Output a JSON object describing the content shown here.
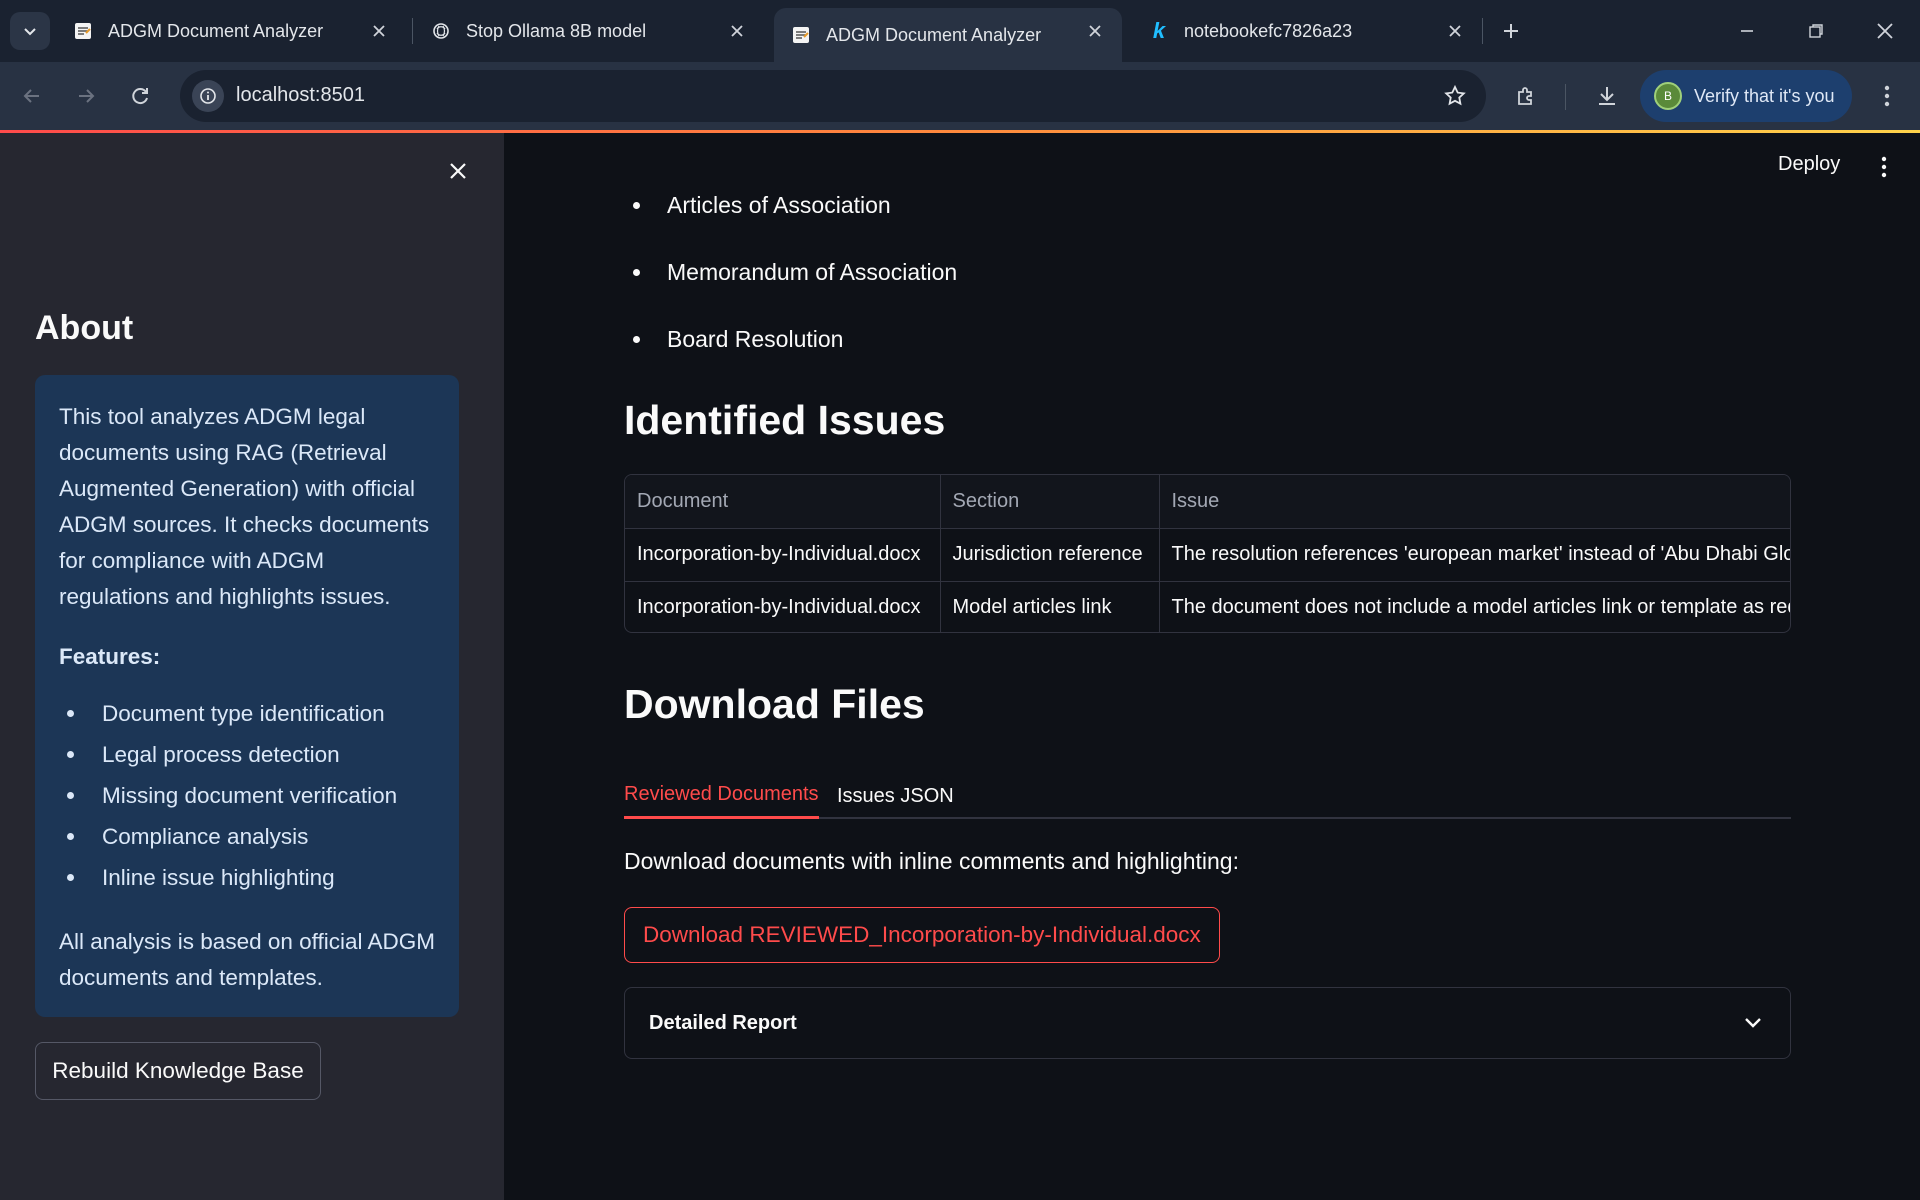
{
  "browser": {
    "tabs": [
      {
        "title": "ADGM Document Analyzer",
        "icon": "streamlit-doc-icon"
      },
      {
        "title": "Stop Ollama 8B model",
        "icon": "chatgpt-icon"
      },
      {
        "title": "ADGM Document Analyzer",
        "icon": "streamlit-doc-icon",
        "active": true
      },
      {
        "title": "notebookefc7826a23",
        "icon": "kaggle-icon"
      }
    ],
    "url": "localhost:8501",
    "verify_label": "Verify that it's you",
    "avatar_letter": "B"
  },
  "sidebar": {
    "title": "About",
    "intro": "This tool analyzes ADGM legal documents using RAG (Retrieval Augmented Generation) with official ADGM sources. It checks documents for compliance with ADGM regulations and highlights issues.",
    "features_label": "Features:",
    "features": [
      "Document type identification",
      "Legal process detection",
      "Missing document verification",
      "Compliance analysis",
      "Inline issue highlighting"
    ],
    "footer": "All analysis is based on official ADGM documents and templates.",
    "rebuild_label": "Rebuild Knowledge Base"
  },
  "header": {
    "deploy_label": "Deploy"
  },
  "main": {
    "documents": [
      "Articles of Association",
      "Memorandum of Association",
      "Board Resolution"
    ],
    "issues_title": "Identified Issues",
    "issues_table": {
      "columns": [
        "Document",
        "Section",
        "Issue"
      ],
      "rows": [
        [
          "Incorporation-by-Individual.docx",
          "Jurisdiction reference",
          "The resolution references 'european market' instead of 'Abu Dhabi Glob"
        ],
        [
          "Incorporation-by-Individual.docx",
          "Model articles link",
          "The document does not include a model articles link or template as req"
        ]
      ]
    },
    "download_title": "Download Files",
    "download_tabs": [
      "Reviewed Documents",
      "Issues JSON"
    ],
    "download_text": "Download documents with inline comments and highlighting:",
    "download_button": "Download REVIEWED_Incorporation-by-Individual.docx",
    "expander_label": "Detailed Report"
  },
  "colors": {
    "accent": "#ff4b4b",
    "info_box": "#1c3656",
    "background": "#0e1117",
    "sidebar": "#262730"
  }
}
